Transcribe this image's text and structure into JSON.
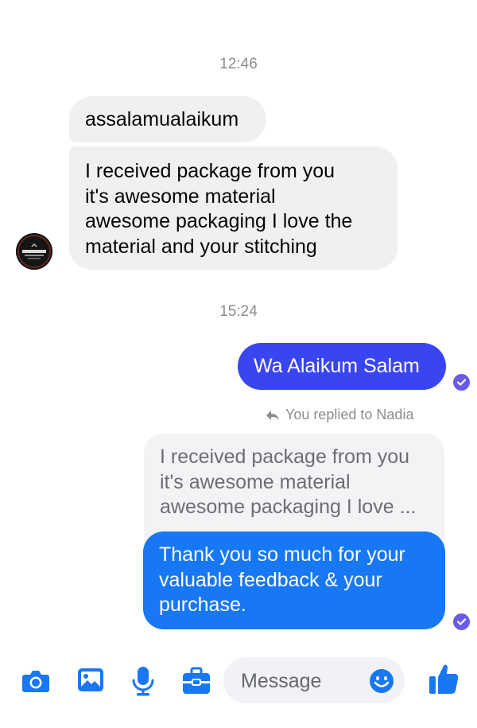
{
  "colors": {
    "accent_blue": "#1877f2",
    "accent_purple": "#3a45f2",
    "incoming_bg": "#f0f0f0",
    "muted_text": "#8a8d91"
  },
  "conversation": {
    "timestamp_1": "12:46",
    "incoming_1": "assalamualaikum",
    "incoming_2_lines": [
      "I received package from you",
      "it's awesome material",
      "awesome packaging I love the",
      "material and your stitching"
    ],
    "timestamp_2": "15:24",
    "outgoing_1": "Wa Alaikum Salam",
    "reply_label": "You replied to Nadia",
    "quoted_lines": [
      "I received package from you",
      "it's awesome material",
      "awesome packaging I love ..."
    ],
    "outgoing_2_lines": [
      "Thank you so much for your",
      "valuable  feedback & your",
      "purchase."
    ]
  },
  "composer": {
    "placeholder": "Message",
    "icons": [
      "camera-icon",
      "gallery-icon",
      "microphone-icon",
      "toolbox-icon",
      "emoji-icon",
      "thumbs-up-icon"
    ]
  }
}
